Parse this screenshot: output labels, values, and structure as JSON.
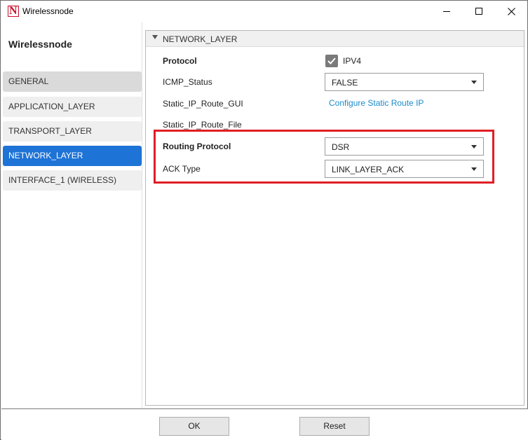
{
  "window": {
    "title": "Wirelessnode",
    "icon": "netsim-logo-icon",
    "icon_letter": "N",
    "controls": [
      "minimize-icon",
      "maximize-icon",
      "close-icon"
    ]
  },
  "sidebar": {
    "node_title": "Wirelessnode",
    "items": [
      {
        "label": "GENERAL",
        "state": "normal"
      },
      {
        "label": "APPLICATION_LAYER",
        "state": "normal"
      },
      {
        "label": "TRANSPORT_LAYER",
        "state": "normal"
      },
      {
        "label": "NETWORK_LAYER",
        "state": "selected"
      },
      {
        "label": "INTERFACE_1 (WIRELESS)",
        "state": "normal"
      }
    ]
  },
  "section": {
    "title": "NETWORK_LAYER",
    "properties": {
      "protocol": {
        "label": "Protocol",
        "checkbox_label": "IPV4",
        "checked": true
      },
      "icmp_status": {
        "label": "ICMP_Status",
        "value": "FALSE"
      },
      "static_ip_route_gui": {
        "label": "Static_IP_Route_GUI",
        "link_text": "Configure Static Route IP"
      },
      "static_ip_route_file": {
        "label": "Static_IP_Route_File"
      },
      "routing_protocol": {
        "label": "Routing Protocol",
        "value": "DSR"
      },
      "ack_type": {
        "label": "ACK Type",
        "value": "LINK_LAYER_ACK"
      }
    }
  },
  "buttons": {
    "ok": "OK",
    "reset": "Reset"
  },
  "colors": {
    "accent": "#1e73d6",
    "highlight": "#e01e25",
    "link": "#1a8bc9",
    "brand": "#c8102e"
  }
}
